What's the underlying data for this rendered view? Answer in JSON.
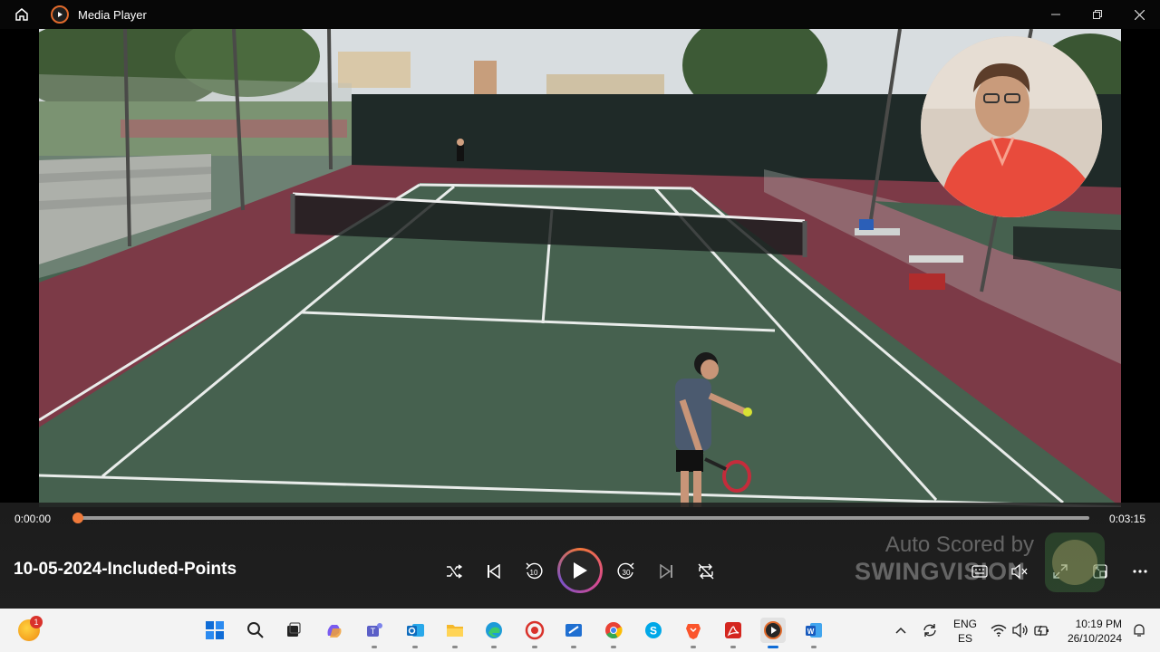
{
  "window": {
    "title": "Media Player"
  },
  "player": {
    "current_time": "0:00:00",
    "total_time": "0:03:15",
    "progress": 0.0,
    "media_title": "10-05-2024-Included-Points",
    "watermark_line1": "Auto Scored by",
    "watermark_line2": "SWINGVISION"
  },
  "controls": {
    "shuffle": "shuffle-icon",
    "previous": "previous-icon",
    "skip_back": "10",
    "play": "play-icon",
    "skip_forward": "30",
    "next": "next-icon",
    "repeat": "repeat-off-icon",
    "right": [
      "subtitles-icon",
      "mute-icon",
      "fullscreen-icon",
      "miniplayer-icon",
      "more-icon"
    ]
  },
  "taskbar": {
    "notification_count": "1",
    "apps": [
      "windows-start-icon",
      "search-icon",
      "task-view-icon",
      "copilot-icon",
      "teams-icon",
      "outlook-icon",
      "file-explorer-icon",
      "edge-icon",
      "tracker-app-icon",
      "snipping-tool-icon",
      "chrome-icon",
      "skype-icon",
      "brave-icon",
      "acrobat-icon",
      "media-player-icon",
      "word-icon"
    ],
    "language_line1": "ENG",
    "language_line2": "ES",
    "time": "10:19 PM",
    "date": "26/10/2024"
  },
  "colors": {
    "accent": "#f07a3a",
    "court_green": "#46614f",
    "court_red": "#7c3a47"
  }
}
